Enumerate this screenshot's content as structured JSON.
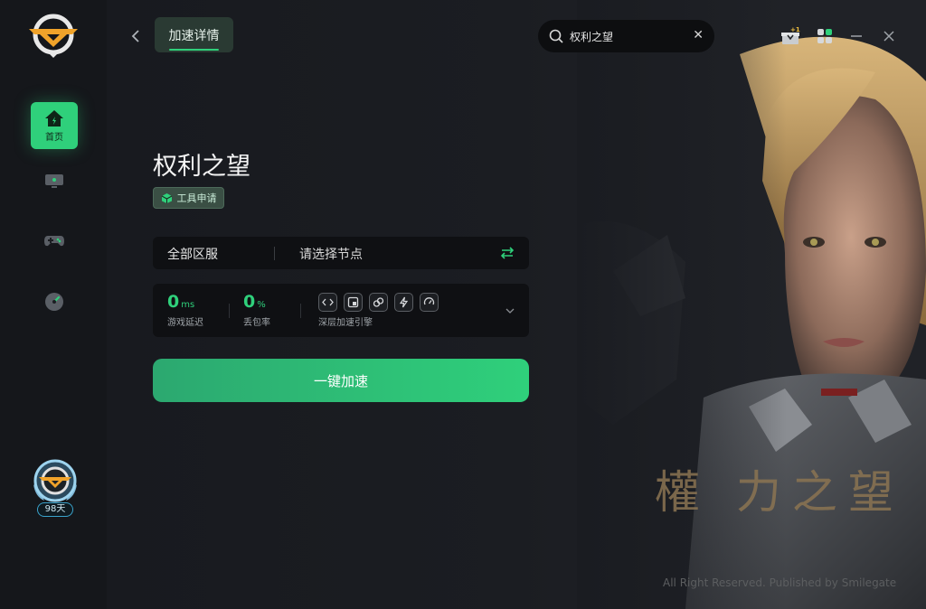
{
  "sidebar": {
    "home_label": "首页",
    "member_days": "98天",
    "items": [
      {
        "icon": "home-icon"
      },
      {
        "icon": "monitor-icon"
      },
      {
        "icon": "gamepad-icon"
      },
      {
        "icon": "speedometer-icon"
      }
    ]
  },
  "header": {
    "tab_label": "加速详情",
    "search_value": "权利之望"
  },
  "game": {
    "title": "权利之望",
    "badge_label": "工具申请",
    "art_title": "權 力之望",
    "art_copyright": "All Right Reserved. Published by Smilegate"
  },
  "server": {
    "region": "全部区服",
    "node_placeholder": "请选择节点"
  },
  "stats": {
    "latency_value": "0",
    "latency_unit": "ms",
    "latency_label": "游戏延迟",
    "loss_value": "0",
    "loss_unit": "%",
    "loss_label": "丢包率",
    "engine_label": "深层加速引擎"
  },
  "boost_button": "一键加速",
  "colors": {
    "accent": "#2fd07b",
    "background": "#121418",
    "panel": "#0f1013"
  }
}
